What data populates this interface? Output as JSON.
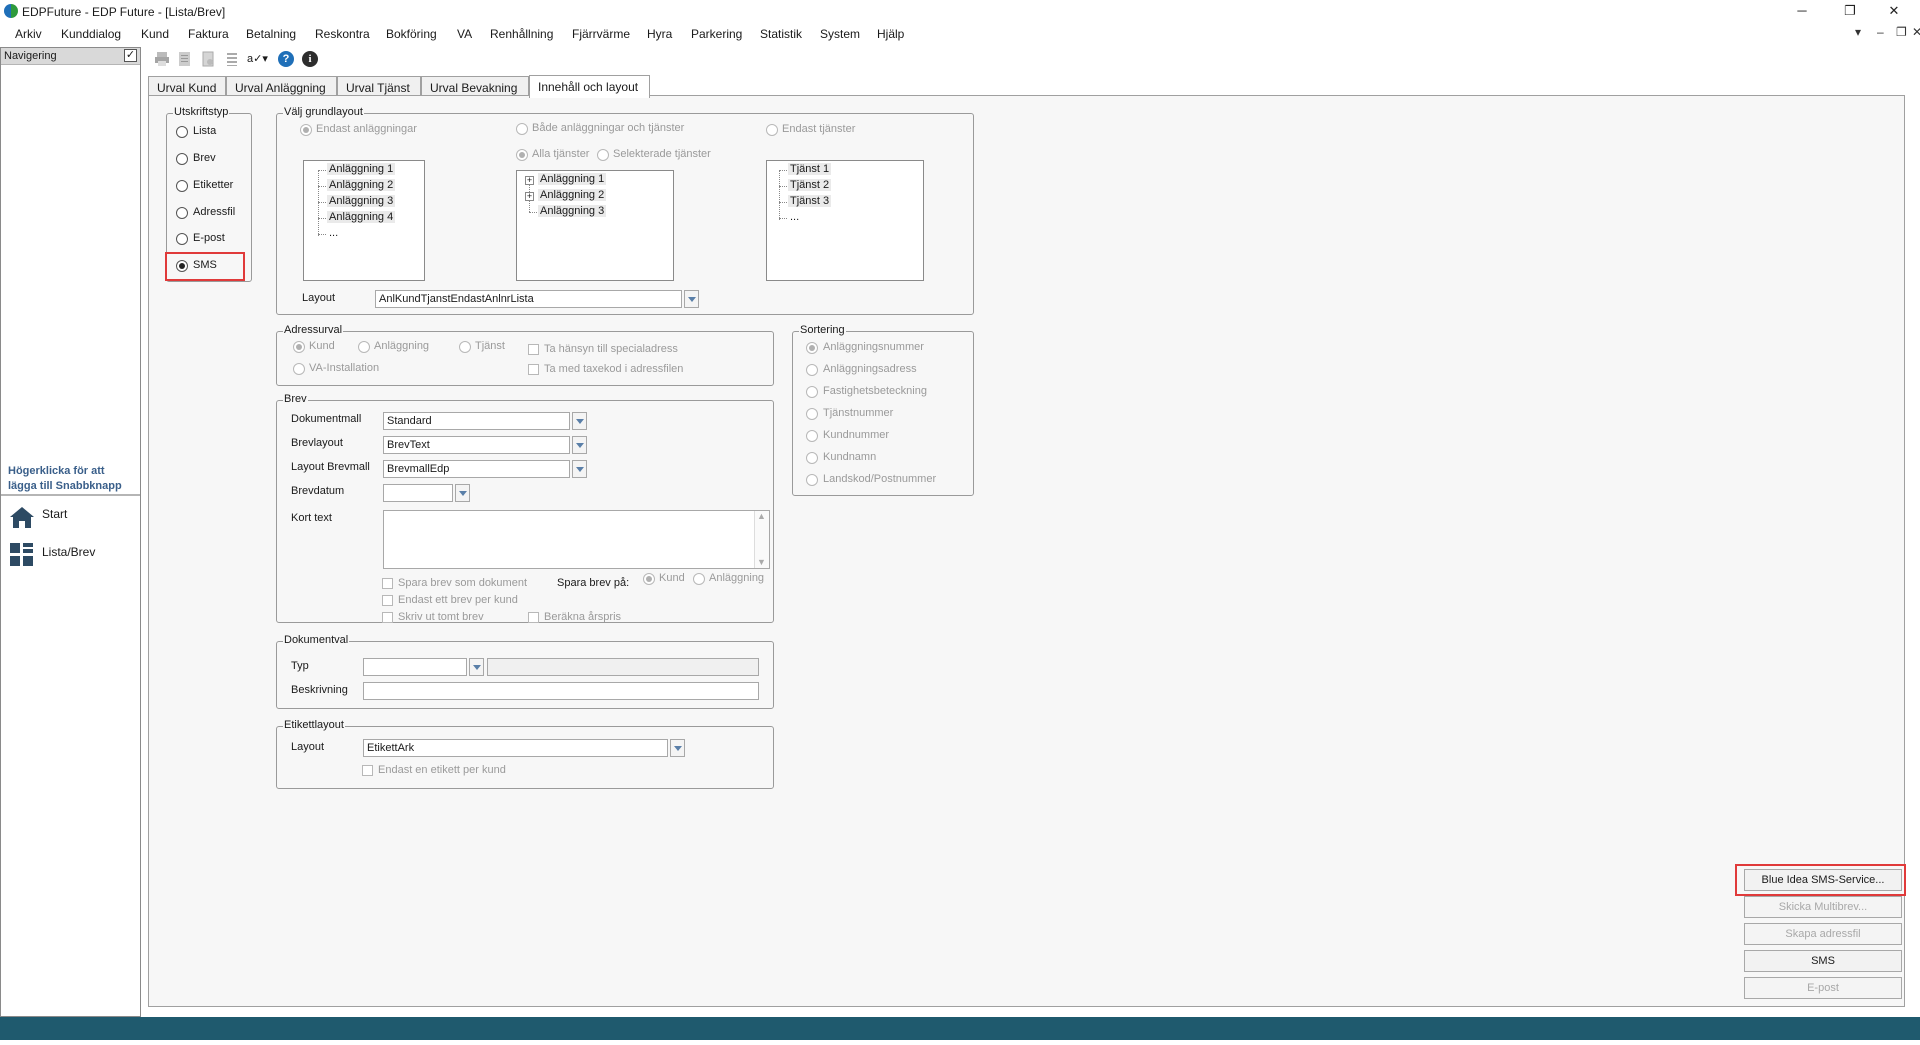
{
  "window": {
    "title": "EDPFuture - EDP Future - [Lista/Brev]",
    "minimize": "─",
    "restore": "❐",
    "close": "✕",
    "mdi_dropdown": "▾",
    "mdi_minimize": "–",
    "mdi_restore": "❐",
    "mdi_close": "✕"
  },
  "menu": [
    "Arkiv",
    "Kunddialog",
    "Kund",
    "Faktura",
    "Betalning",
    "Reskontra",
    "Bokföring",
    "VA",
    "Renhållning",
    "Fjärrvärme",
    "Hyra",
    "Parkering",
    "Statistik",
    "System",
    "Hjälp"
  ],
  "nav": {
    "header": "Navigering",
    "hint": "Högerklicka för att lägga till Snabbknapp",
    "items": [
      {
        "label": "Start",
        "icon": "home-icon"
      },
      {
        "label": "Lista/Brev",
        "icon": "grid-icon"
      }
    ]
  },
  "toolbar": {
    "icons": [
      "print-icon",
      "print-preview-icon",
      "page-icon",
      "list-icon",
      "spellcheck-icon",
      "help-icon",
      "info-icon"
    ],
    "spell_label": "a✓▾",
    "help_glyph": "?",
    "info_glyph": "i"
  },
  "tabs": [
    {
      "label": "Urval Kund",
      "active": false
    },
    {
      "label": "Urval Anläggning",
      "active": false
    },
    {
      "label": "Urval Tjänst",
      "active": false
    },
    {
      "label": "Urval Bevakning",
      "active": false
    },
    {
      "label": "Innehåll och layout",
      "active": true
    }
  ],
  "utskriftstyp": {
    "title": "Utskriftstyp",
    "options": [
      "Lista",
      "Brev",
      "Etiketter",
      "Adressfil",
      "E-post",
      "SMS"
    ],
    "selected": "SMS"
  },
  "grundlayout": {
    "title": "Välj grundlayout",
    "opt1": "Endast anläggningar",
    "opt2": "Både anläggningar och tjänster",
    "opt3": "Endast tjänster",
    "sub1": "Alla tjänster",
    "sub2": "Selekterade tjänster",
    "tree1": [
      "Anläggning 1",
      "Anläggning 2",
      "Anläggning 3",
      "Anläggning 4",
      "..."
    ],
    "tree2": [
      "Anläggning 1",
      "Anläggning 2",
      "Anläggning 3"
    ],
    "tree3": [
      "Tjänst 1",
      "Tjänst 2",
      "Tjänst 3",
      "..."
    ],
    "layout_label": "Layout",
    "layout_value": "AnlKundTjanstEndastAnlnrLista"
  },
  "adressurval": {
    "title": "Adressurval",
    "kund": "Kund",
    "anlaggning": "Anläggning",
    "tjanst": "Tjänst",
    "va": "VA-Installation",
    "cb1": "Ta hänsyn till specialadress",
    "cb2": "Ta med taxekod i adressfilen"
  },
  "sortering": {
    "title": "Sortering",
    "options": [
      "Anläggningsnummer",
      "Anläggningsadress",
      "Fastighetsbeteckning",
      "Tjänstnummer",
      "Kundnummer",
      "Kundnamn",
      "Landskod/Postnummer"
    ]
  },
  "brev": {
    "title": "Brev",
    "dokumentmall_label": "Dokumentmall",
    "dokumentmall": "Standard",
    "brevlayout_label": "Brevlayout",
    "brevlayout": "BrevText",
    "layout_brevmall_label": "Layout Brevmall",
    "layout_brevmall": "BrevmallEdp",
    "brevdatum_label": "Brevdatum",
    "brevdatum": "",
    "korttext_label": "Kort text",
    "korttext": "",
    "cb_spara": "Spara brev som dokument",
    "cb_endast": "Endast ett brev per kund",
    "cb_skriv": "Skriv ut tomt brev",
    "cb_berakna": "Beräkna årspris",
    "spara_pa": "Spara brev på:",
    "spara_kund": "Kund",
    "spara_anl": "Anläggning"
  },
  "dokumentval": {
    "title": "Dokumentval",
    "typ_label": "Typ",
    "typ": "",
    "typ_desc": "",
    "beskrivning_label": "Beskrivning",
    "beskrivning": ""
  },
  "etikettlayout": {
    "title": "Etikettlayout",
    "layout_label": "Layout",
    "layout": "EtikettArk",
    "cb": "Endast en etikett per kund"
  },
  "buttons": {
    "sms_service": "Blue Idea SMS-Service...",
    "skicka_multibrev": "Skicka Multibrev...",
    "skapa_adressfil": "Skapa adressfil",
    "sms": "SMS",
    "epost": "E-post"
  },
  "colors": {
    "highlight": "#e03a3a",
    "statusbar": "#1f5a6e",
    "accent_blue": "#1f6fb8"
  }
}
